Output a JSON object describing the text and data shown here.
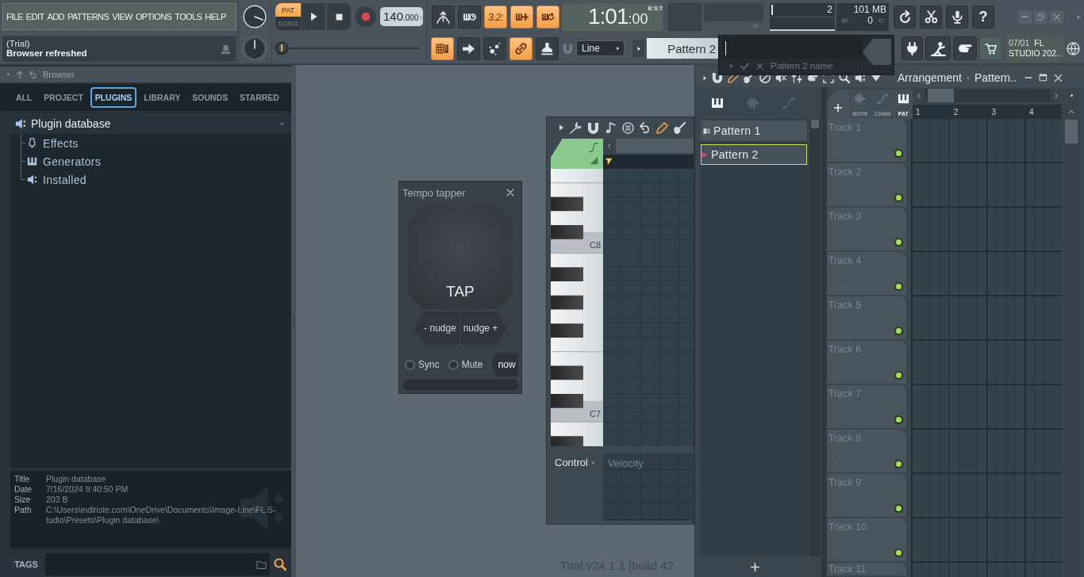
{
  "menu": {
    "items": [
      "FILE",
      "EDIT",
      "ADD",
      "PATTERNS",
      "VIEW",
      "OPTIONS",
      "TOOLS",
      "HELP"
    ]
  },
  "hint_bar": {
    "title": "(Trial)",
    "message": "Browser refreshed"
  },
  "transport": {
    "modes": [
      {
        "label": "PAT",
        "selected": true
      },
      {
        "label": "SONG",
        "selected": false
      }
    ],
    "tempo": "140",
    "tempo_fraction": ".000"
  },
  "record_tools": [
    {
      "on": false
    },
    {
      "on": false
    },
    {
      "label": "3.2:",
      "on": true
    },
    {
      "on": true
    },
    {
      "on": true
    }
  ],
  "song_position": {
    "time": "1:01",
    "ticks": ":00",
    "format": "B:S:T"
  },
  "monitor": {
    "cpu": {
      "value": "2",
      "level": 0.02
    },
    "memory": "101 MB",
    "polyphony": "0"
  },
  "help_button": {
    "label": "?"
  },
  "pitch_slider": {
    "level": 0
  },
  "edit_tools": [
    {
      "on": true
    },
    {
      "on": false
    },
    {
      "on": false
    },
    {
      "on": true
    },
    {
      "on": false
    }
  ],
  "snap": {
    "value": "Line"
  },
  "pattern_selector": {
    "value": "Pattern 2"
  },
  "rename_popup": {
    "caption": "Pattern 2 name"
  },
  "news": {
    "date": "07/01",
    "lines": [
      "FL",
      "STUDIO 202.."
    ]
  },
  "browser": {
    "title": "Browser",
    "tabs": [
      {
        "label": "ALL",
        "selected": false
      },
      {
        "label": "PROJECT",
        "selected": false
      },
      {
        "label": "PLUGINS",
        "selected": true
      },
      {
        "label": "LIBRARY",
        "selected": false
      },
      {
        "label": "SOUNDS",
        "selected": false
      },
      {
        "label": "STARRED",
        "selected": false
      }
    ],
    "tree": [
      {
        "label": "Plugin database",
        "expanded": true,
        "children": [
          {
            "label": "Effects"
          },
          {
            "label": "Generators"
          },
          {
            "label": "Installed"
          }
        ]
      }
    ],
    "info": [
      {
        "label": "Title",
        "value": [
          "Plugin database"
        ]
      },
      {
        "label": "Date",
        "value": [
          "7/16/2024 9:40:50 PM"
        ]
      },
      {
        "label": "Size",
        "value": [
          "203 B"
        ]
      },
      {
        "label": "Path",
        "value": [
          "C:\\Users\\indiriste.com\\OneDrive\\Documents\\Image-Line\\FL S-",
          "tudio\\Presets\\Plugin database\\"
        ]
      }
    ],
    "tags": {
      "label": "TAGS"
    }
  },
  "tempo_tapper": {
    "title": "Tempo tapper",
    "pad": "TAP",
    "nudge": [
      "- nudge",
      "nudge +"
    ],
    "options": [
      {
        "label": "Sync",
        "on": false
      },
      {
        "label": "Mute",
        "on": false
      }
    ],
    "now": "now"
  },
  "piano_roll": {
    "key_labels": [
      "C8",
      "C7"
    ],
    "control": {
      "label": "Control",
      "target": "Velocity"
    }
  },
  "playlist": {
    "breadcrumb": [
      "Arrangement",
      "Pattern.."
    ],
    "picker_modes": [
      {
        "selected": true
      },
      {
        "selected": false
      },
      {
        "selected": false
      }
    ],
    "patterns": [
      {
        "label": "Pattern 1",
        "selected": false
      },
      {
        "label": "Pattern 2",
        "selected": true
      }
    ],
    "filters": [
      {
        "label": "NOTE",
        "selected": false
      },
      {
        "label": "CHAN",
        "selected": false
      },
      {
        "label": "PAT",
        "selected": true
      }
    ],
    "bars": [
      "1",
      "2",
      "3",
      "4"
    ],
    "tracks": [
      {
        "name": "Track 1",
        "on": true
      },
      {
        "name": "Track 2",
        "on": true
      },
      {
        "name": "Track 3",
        "on": true
      },
      {
        "name": "Track 4",
        "on": true
      },
      {
        "name": "Track 5",
        "on": true
      },
      {
        "name": "Track 6",
        "on": true
      },
      {
        "name": "Track 7",
        "on": true
      },
      {
        "name": "Track 8",
        "on": true
      },
      {
        "name": "Track 9",
        "on": true
      },
      {
        "name": "Track 10",
        "on": true
      }
    ],
    "partial_track": "Track 11"
  },
  "status": "Trial v24.1.1 [build 42"
}
